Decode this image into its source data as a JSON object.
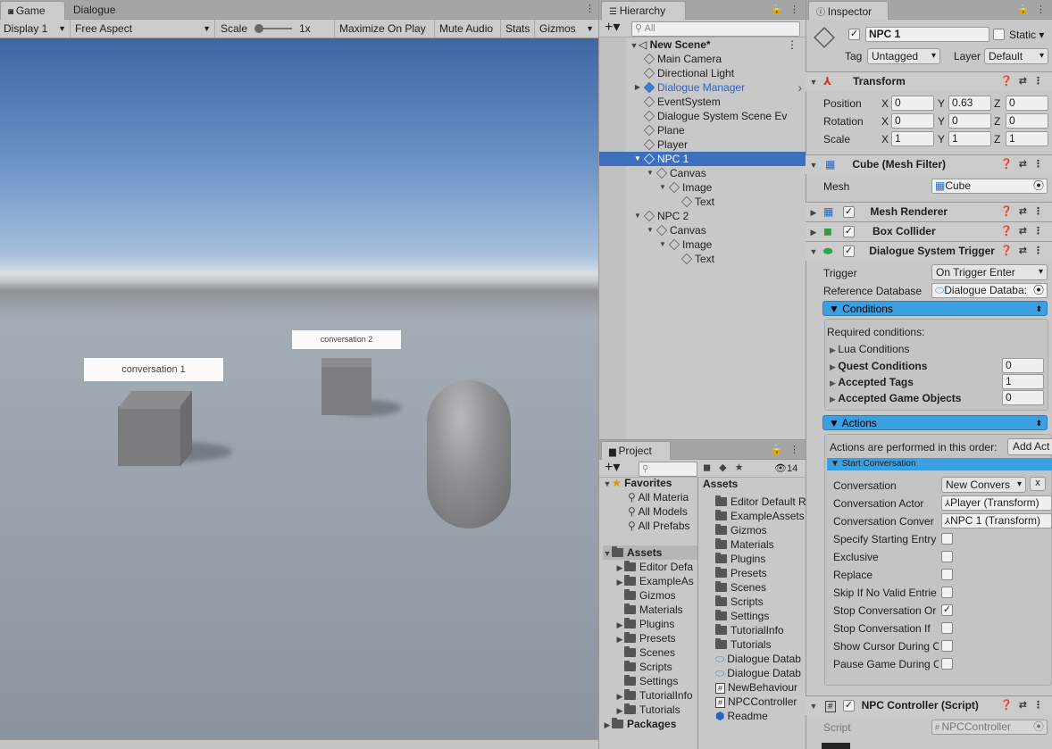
{
  "game": {
    "tabs": [
      "Game",
      "Dialogue"
    ],
    "display": "Display 1",
    "aspect": "Free Aspect",
    "scale_label": "Scale",
    "scale_value": "1x",
    "maximize": "Maximize On Play",
    "mute": "Mute Audio",
    "stats": "Stats",
    "gizmos": "Gizmos",
    "label1": "conversation 1",
    "label2": "conversation 2"
  },
  "hierarchy": {
    "title": "Hierarchy",
    "search_placeholder": "All",
    "scene": "New Scene*",
    "items": [
      "Main Camera",
      "Directional Light",
      "Dialogue Manager",
      "EventSystem",
      "Dialogue System Scene Ev",
      "Plane",
      "Player",
      "NPC 1",
      "Canvas",
      "Image",
      "Text",
      "NPC 2",
      "Canvas",
      "Image",
      "Text"
    ]
  },
  "project": {
    "title": "Project",
    "count": "14",
    "favorites_label": "Favorites",
    "favorites": [
      "All Materia",
      "All Models",
      "All Prefabs"
    ],
    "assets_label": "Assets",
    "tree": [
      "Editor Defa",
      "ExampleAs",
      "Gizmos",
      "Materials",
      "Plugins",
      "Presets",
      "Scenes",
      "Scripts",
      "Settings",
      "TutorialInfo",
      "Tutorials"
    ],
    "packages": "Packages",
    "assets_header": "Assets",
    "files": [
      "Editor Default R",
      "ExampleAssets",
      "Gizmos",
      "Materials",
      "Plugins",
      "Presets",
      "Scenes",
      "Scripts",
      "Settings",
      "TutorialInfo",
      "Tutorials",
      "Dialogue Datab",
      "Dialogue Datab",
      "NewBehaviour",
      "NPCController",
      "Readme"
    ]
  },
  "inspector": {
    "title": "Inspector",
    "name": "NPC 1",
    "static": "Static",
    "tag_label": "Tag",
    "tag": "Untagged",
    "layer_label": "Layer",
    "layer": "Default",
    "transform": {
      "title": "Transform",
      "position": "Position",
      "rotation": "Rotation",
      "scale": "Scale",
      "pos": [
        "0",
        "0.63",
        "0"
      ],
      "rot": [
        "0",
        "0",
        "0"
      ],
      "scl": [
        "1",
        "1",
        "1"
      ],
      "axes": [
        "X",
        "Y",
        "Z"
      ]
    },
    "meshfilter": {
      "title": "Cube (Mesh Filter)",
      "mesh_label": "Mesh",
      "mesh": "Cube"
    },
    "meshrenderer": "Mesh Renderer",
    "boxcollider": "Box Collider",
    "dst": {
      "title": "Dialogue System Trigger",
      "trigger_label": "Trigger",
      "trigger": "On Trigger Enter",
      "refdb_label": "Reference Database",
      "refdb": "Dialogue Databa:",
      "conditions": "Conditions",
      "required": "Required conditions:",
      "lua": "Lua Conditions",
      "quest": "Quest Conditions",
      "quest_val": "0",
      "tags": "Accepted Tags",
      "tags_val": "1",
      "gos": "Accepted Game Objects",
      "gos_val": "0",
      "actions": "Actions",
      "order": "Actions are performed in this order:",
      "add": "Add Act",
      "start": "Start Conversation",
      "conv_label": "Conversation",
      "conv": "New Convers",
      "actor_label": "Conversation Actor",
      "actor": "Player (Transform)",
      "conversant_label": "Conversation Conver",
      "conversant": "NPC 1 (Transform)",
      "opts": [
        "Specify Starting Entry",
        "Exclusive",
        "Replace",
        "Skip If No Valid Entrie",
        "Stop Conversation Or",
        "Stop Conversation If",
        "Show Cursor During C",
        "Pause Game During C"
      ],
      "checked": [
        false,
        false,
        false,
        false,
        true,
        false,
        false,
        false
      ]
    },
    "npcc": {
      "title": "NPC Controller (Script)",
      "script_label": "Script",
      "script": "NPCController"
    }
  }
}
